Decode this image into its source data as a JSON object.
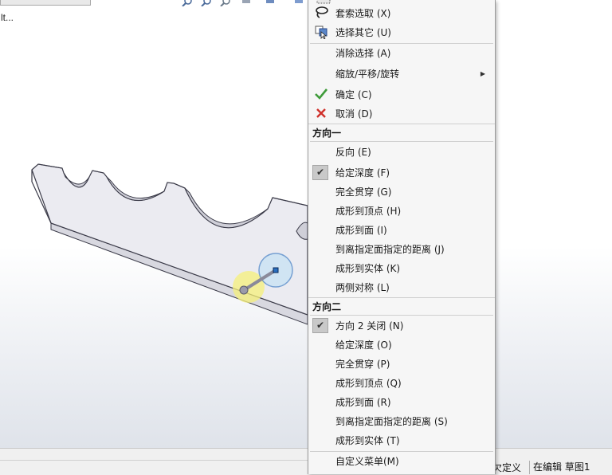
{
  "window": {
    "title_fragment": "lt..."
  },
  "colors": {
    "part_fill": "#ebebf1",
    "part_edge": "#3a3a48",
    "highlight_yellow": "#f5f07a",
    "handle_blue": "#2a6fbf",
    "check_green": "#3f9b3a",
    "cancel_red": "#d0302a"
  },
  "toolbar": {
    "icons": [
      "zoom-to-fit-icon",
      "zoom-area-icon",
      "previous-view-icon",
      "section-view-icon",
      "view-orientation-icon",
      "display-style-icon"
    ]
  },
  "context_menu": {
    "top_items": [
      {
        "icon": "lasso-select-icon",
        "label": "套索选取 (X)"
      },
      {
        "icon": "select-other-icon",
        "label": "选择其它 (U)"
      }
    ],
    "clear_selection": "消除选择 (A)",
    "zoom_pan_rotate": "缩放/平移/旋转",
    "ok": "确定 (C)",
    "cancel": "取消 (D)",
    "direction1": {
      "header": "方向一",
      "items": [
        {
          "label": "反向 (E)",
          "checked": false
        },
        {
          "label": "给定深度 (F)",
          "checked": true
        },
        {
          "label": "完全贯穿 (G)",
          "checked": false
        },
        {
          "label": "成形到顶点 (H)",
          "checked": false
        },
        {
          "label": "成形到面 (I)",
          "checked": false
        },
        {
          "label": "到离指定面指定的距离 (J)",
          "checked": false
        },
        {
          "label": "成形到实体 (K)",
          "checked": false
        },
        {
          "label": "两侧对称 (L)",
          "checked": false
        }
      ]
    },
    "direction2": {
      "header": "方向二",
      "items": [
        {
          "label": "方向 2 关闭 (N)",
          "checked": true
        },
        {
          "label": "给定深度 (O)",
          "checked": false
        },
        {
          "label": "完全贯穿 (P)",
          "checked": false
        },
        {
          "label": "成形到顶点 (Q)",
          "checked": false
        },
        {
          "label": "成形到面 (R)",
          "checked": false
        },
        {
          "label": "到离指定面指定的距离 (S)",
          "checked": false
        },
        {
          "label": "成形到实体 (T)",
          "checked": false
        }
      ]
    },
    "customize": "自定义菜单(M)"
  },
  "status_bar": {
    "left_fragment": "欠定义",
    "right": "在编辑 草图1"
  }
}
